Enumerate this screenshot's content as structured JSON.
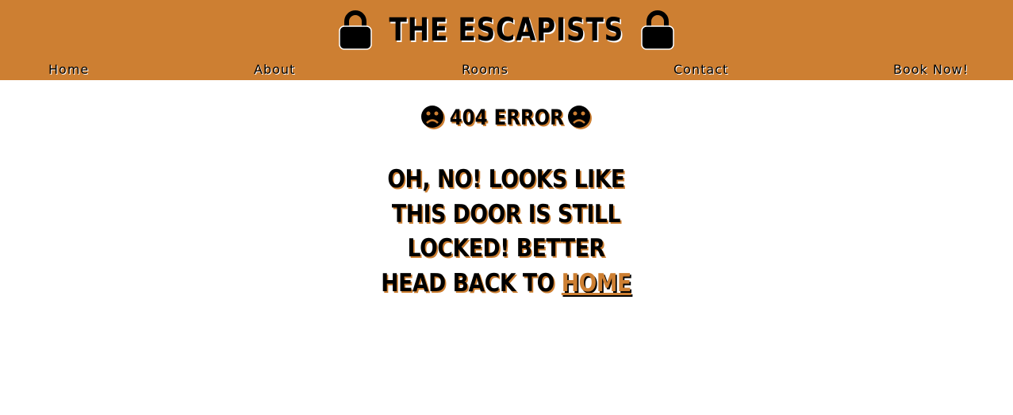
{
  "header": {
    "title": "THE ESCAPISTS",
    "brand_color": "#cd7f32",
    "title_icon": "lock-icon"
  },
  "nav": {
    "items": [
      {
        "label": "Home"
      },
      {
        "label": "About"
      },
      {
        "label": "Rooms"
      },
      {
        "label": "Contact"
      },
      {
        "label": "Book Now!"
      }
    ]
  },
  "main": {
    "error_title": "404 ERROR",
    "error_icon": "sad-face-icon",
    "message_lines": [
      "OH, NO! LOOKS LIKE",
      "THIS DOOR IS STILL",
      "LOCKED! BETTER",
      "HEAD BACK TO"
    ],
    "home_link_label": "HOME"
  }
}
